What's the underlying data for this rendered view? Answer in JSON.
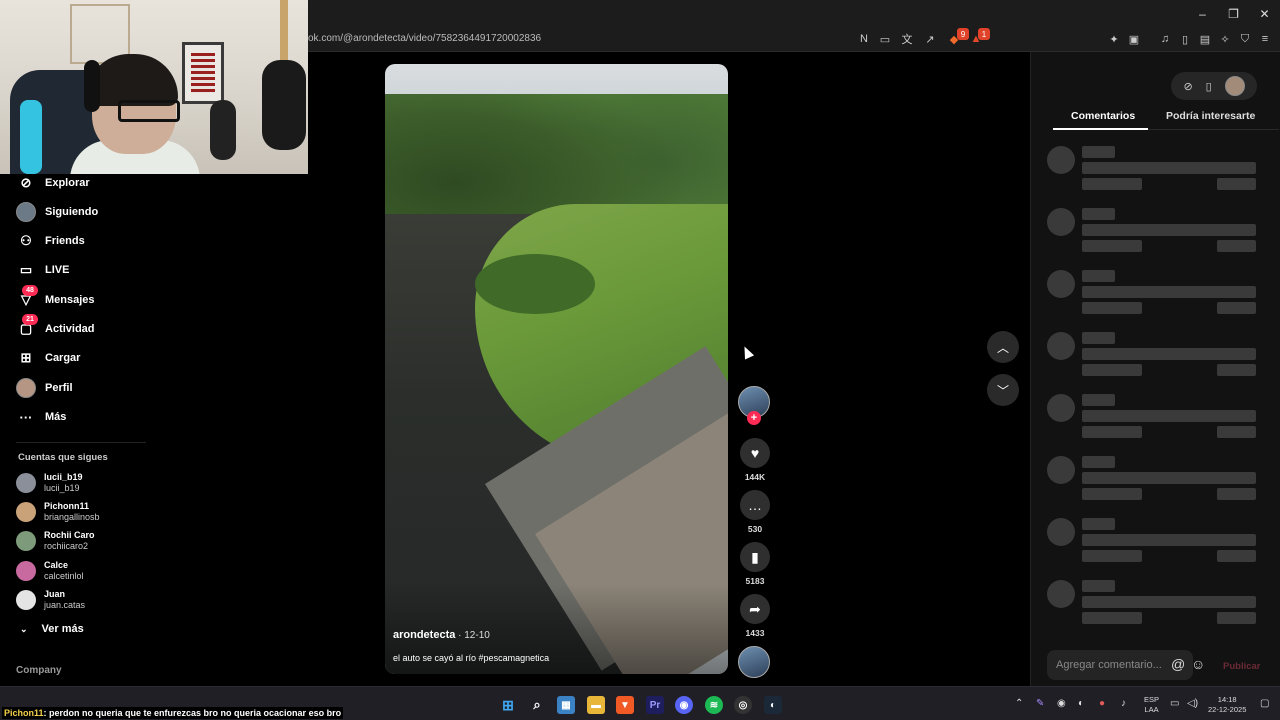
{
  "browser": {
    "url": "ok.com/@arondetecta/video/7582364491720002836",
    "badges": {
      "brave": "9",
      "rewards": "1"
    }
  },
  "sidebar": {
    "items": [
      {
        "label": "Explorar",
        "icon": "compass-icon"
      },
      {
        "label": "Siguiendo",
        "icon": "avatar"
      },
      {
        "label": "Friends",
        "icon": "people-icon"
      },
      {
        "label": "LIVE",
        "icon": "live-tv-icon"
      },
      {
        "label": "Mensajes",
        "icon": "paper-plane-icon",
        "badge": "48"
      },
      {
        "label": "Actividad",
        "icon": "message-icon",
        "badge": "21"
      },
      {
        "label": "Cargar",
        "icon": "plus-square-icon"
      },
      {
        "label": "Perfil",
        "icon": "avatar"
      },
      {
        "label": "Más",
        "icon": "ellipsis-icon"
      }
    ],
    "following_title": "Cuentas que sigues",
    "following": [
      {
        "name": "lucii_b19",
        "handle": "lucii_b19",
        "color": "#8a8f99"
      },
      {
        "name": "Pichonn11",
        "handle": "briangallinosb",
        "color": "#c9a27a"
      },
      {
        "name": "Rochii Caro",
        "handle": "rochiicaro2",
        "color": "#7d9a7a"
      },
      {
        "name": "Calce",
        "handle": "calcetinlol",
        "color": "#c86aa0"
      },
      {
        "name": "Juan",
        "handle": "juan.catas",
        "color": "#e4e4e4"
      }
    ],
    "see_more": "Ver más",
    "company": "Company"
  },
  "video": {
    "author": "arondetecta",
    "date": " · 12-10",
    "caption": "el auto se cayó al río #pescamagnetica"
  },
  "actions": {
    "likes": "144K",
    "comments": "530",
    "saves": "5183",
    "shares": "1433"
  },
  "panel": {
    "tab_comments": "Comentarios",
    "tab_suggested": "Podría interesarte",
    "comment_placeholder": "Agregar comentario...",
    "publish": "Publicar"
  },
  "taskbar": {
    "chat_user": "Pichon11",
    "chat_text": ": perdon no queria que te enfurezcas bro no queria ocacionar eso bro",
    "lang_1": "ESP",
    "lang_2": "LAA",
    "time": "14:18",
    "date": "22-12-2025"
  },
  "colors": {
    "accent": "#fe2c55",
    "background": "#000000"
  }
}
